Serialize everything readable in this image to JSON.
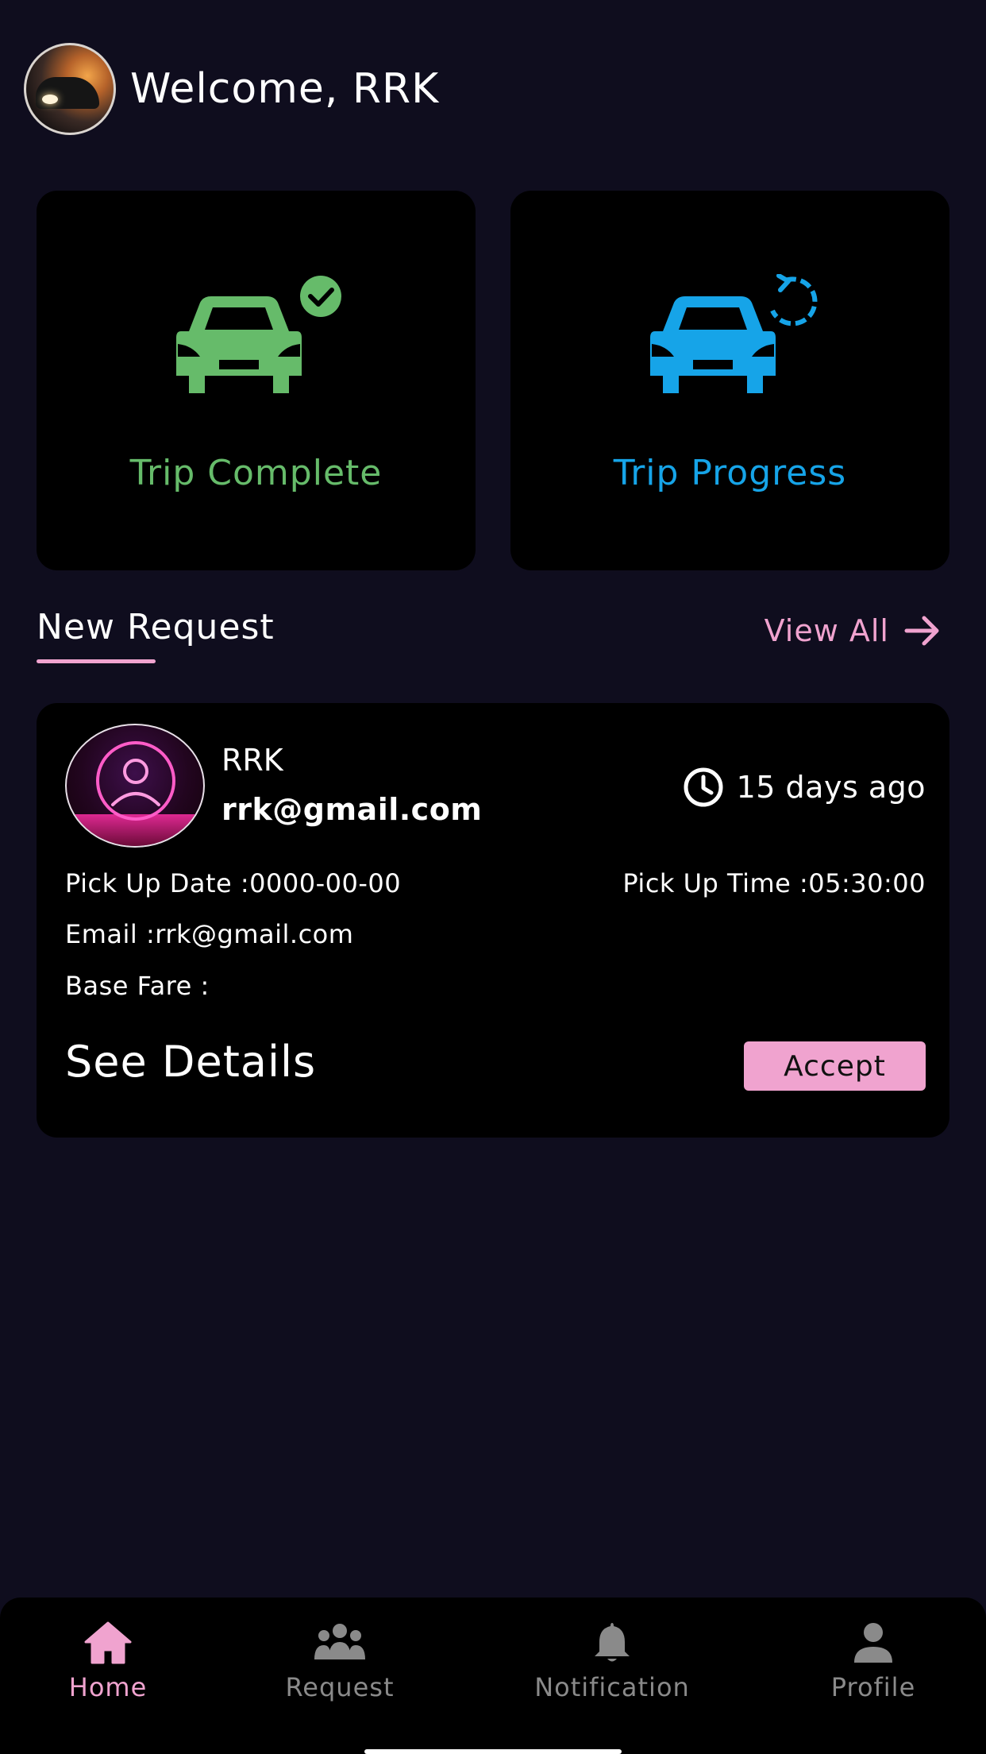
{
  "header": {
    "welcome_text": "Welcome, RRK"
  },
  "stats": {
    "trip_complete_label": "Trip Complete",
    "trip_progress_label": "Trip Progress"
  },
  "section": {
    "title": "New Request",
    "view_all_label": "View All"
  },
  "request": {
    "name": "RRK",
    "email_heading": "rrk@gmail.com",
    "time_ago": "15 days ago",
    "pickup_date": "Pick Up Date :0000-00-00",
    "pickup_time": "Pick Up Time :05:30:00",
    "email_line": "Email :rrk@gmail.com",
    "base_fare": "Base Fare :",
    "see_details_label": "See Details",
    "accept_label": "Accept"
  },
  "bottom_nav": {
    "items": [
      {
        "label": "Home",
        "icon": "home-icon",
        "active": true
      },
      {
        "label": "Request",
        "icon": "group-icon",
        "active": false
      },
      {
        "label": "Notification",
        "icon": "bell-icon",
        "active": false
      },
      {
        "label": "Profile",
        "icon": "person-icon",
        "active": false
      }
    ]
  },
  "colors": {
    "background": "#0f0d1e",
    "card": "#000000",
    "accent_pink": "#f0a3cf",
    "complete_green": "#66bb6a",
    "progress_blue": "#16a4e8",
    "nav_inactive": "#8a8a8a"
  }
}
